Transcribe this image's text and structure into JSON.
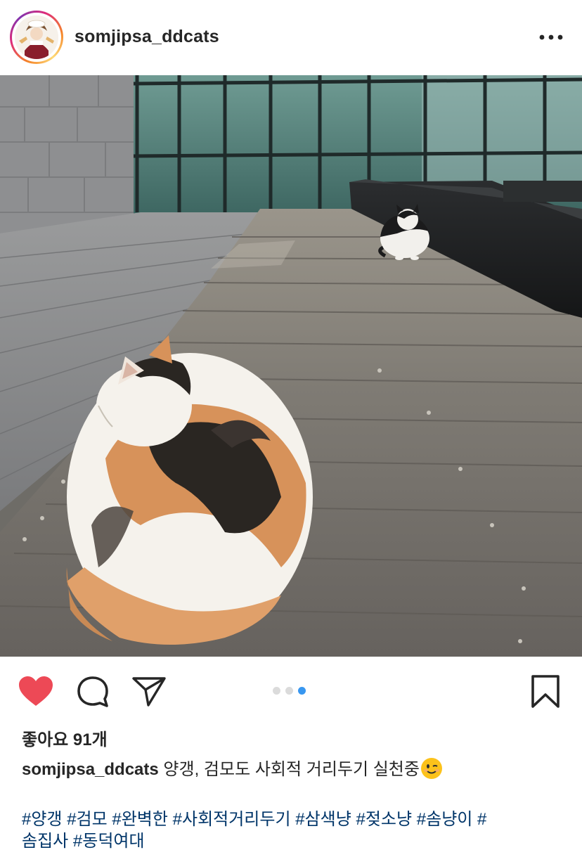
{
  "post": {
    "username": "somjipsa_ddcats",
    "more_label": "•••",
    "likes_text": "좋아요 91개",
    "caption_user": "somjipsa_ddcats",
    "caption_text": "양갱, 검모도 사회적 거리두기 실천중",
    "caption_emoji": "winking-face-emoji",
    "hashtags": [
      "#양갱",
      "#검모",
      "#완벽한",
      "#사회적거리두기",
      "#삼색냥",
      "#젖소냥",
      "#솜냥이",
      "#솜집사",
      "#동덕여대"
    ],
    "carousel": {
      "count": 3,
      "active_index": 2
    }
  },
  "icons": {
    "like": "heart-icon",
    "comment": "comment-icon",
    "share": "share-icon",
    "save": "bookmark-icon",
    "more": "more-options-icon"
  },
  "colors": {
    "like_red": "#ed4956",
    "hashtag_blue": "#003569",
    "carousel_active": "#3897f0",
    "carousel_inactive": "#dbdbdb",
    "text": "#262626"
  }
}
